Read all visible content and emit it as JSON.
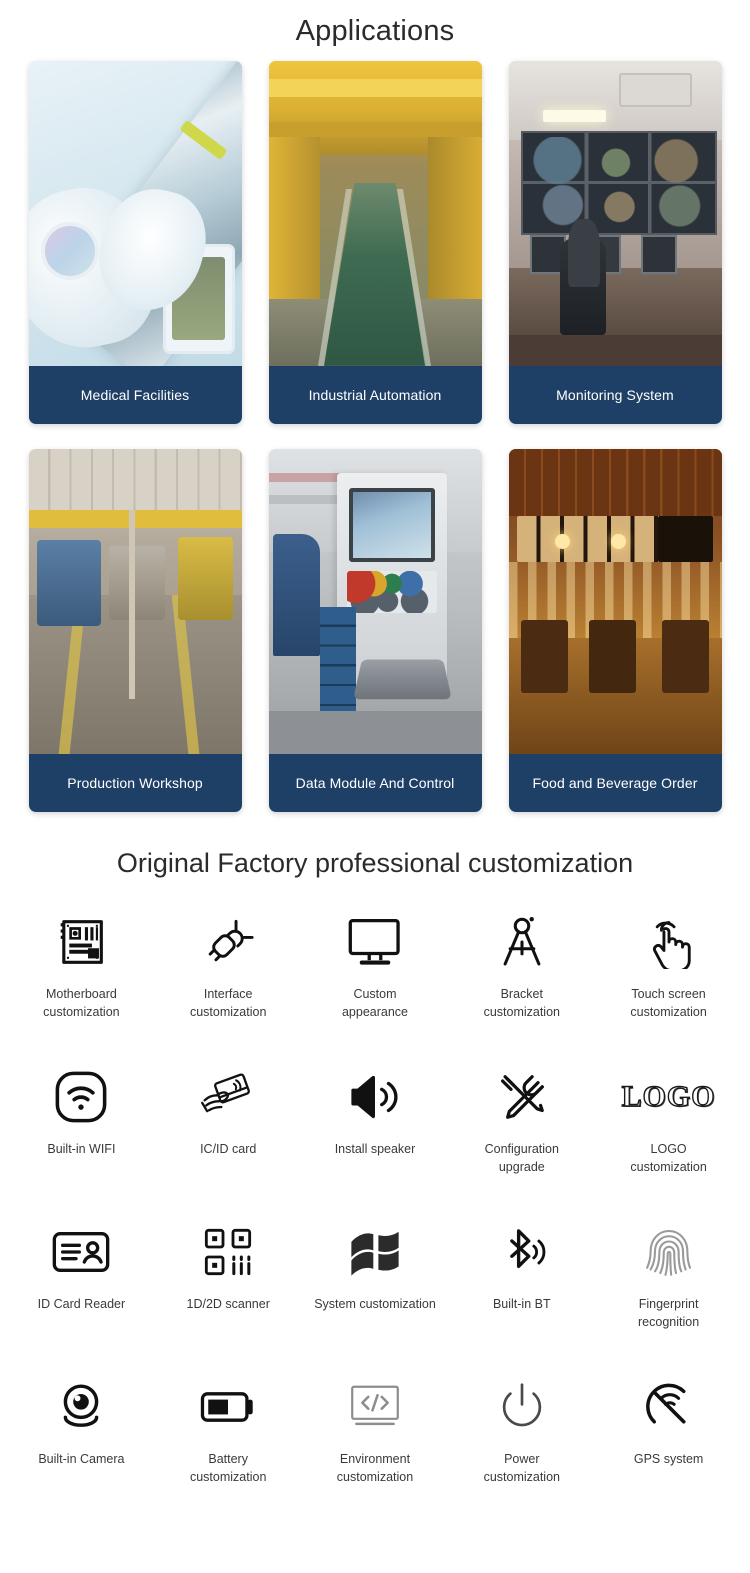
{
  "applications": {
    "title": "Applications",
    "cards": [
      {
        "caption": "Medical Facilities",
        "photo": "medical-facility-photo"
      },
      {
        "caption": "Industrial Automation",
        "photo": "industrial-automation-photo"
      },
      {
        "caption": "Monitoring System",
        "photo": "monitoring-system-photo"
      },
      {
        "caption": "Production Workshop",
        "photo": "production-workshop-photo"
      },
      {
        "caption": "Data Module And Control",
        "photo": "data-module-control-photo"
      },
      {
        "caption": "Food and Beverage Order",
        "photo": "food-beverage-order-photo"
      }
    ]
  },
  "customization": {
    "title": "Original Factory professional customization",
    "items": [
      {
        "icon": "motherboard-icon",
        "label": "Motherboard\ncustomization"
      },
      {
        "icon": "plug-connector-icon",
        "label": "Interface\ncustomization"
      },
      {
        "icon": "monitor-icon",
        "label": "Custom\nappearance"
      },
      {
        "icon": "compass-divider-icon",
        "label": "Bracket\ncustomization"
      },
      {
        "icon": "touch-hand-icon",
        "label": "Touch screen\ncustomization"
      },
      {
        "icon": "wifi-icon",
        "label": "Built-in WIFI"
      },
      {
        "icon": "ic-id-card-icon",
        "label": "IC/ID card"
      },
      {
        "icon": "speaker-icon",
        "label": "Install speaker"
      },
      {
        "icon": "wrench-screwdriver-icon",
        "label": "Configuration\nupgrade"
      },
      {
        "icon": "logo-text-icon",
        "label": "LOGO\ncustomization"
      },
      {
        "icon": "id-card-reader-icon",
        "label": "ID Card Reader"
      },
      {
        "icon": "qr-barcode-scanner-icon",
        "label": "1D/2D scanner"
      },
      {
        "icon": "windows-flag-icon",
        "label": "System customization"
      },
      {
        "icon": "bluetooth-icon",
        "label": "Built-in BT"
      },
      {
        "icon": "fingerprint-icon",
        "label": "Fingerprint\nrecognition"
      },
      {
        "icon": "camera-icon",
        "label": "Built-in Camera"
      },
      {
        "icon": "battery-icon",
        "label": "Battery\ncustomization"
      },
      {
        "icon": "code-screen-icon",
        "label": "Environment\ncustomization"
      },
      {
        "icon": "power-icon",
        "label": "Power\ncustomization"
      },
      {
        "icon": "gps-satellite-icon",
        "label": "GPS system"
      }
    ]
  },
  "colors": {
    "caption_bar": "#1f4066",
    "page_background": "#ffffff",
    "heading_text": "#2b2b2b",
    "label_text": "#3a3a3a",
    "icon_dark": "#111111",
    "icon_gray": "#9a9a9a"
  }
}
